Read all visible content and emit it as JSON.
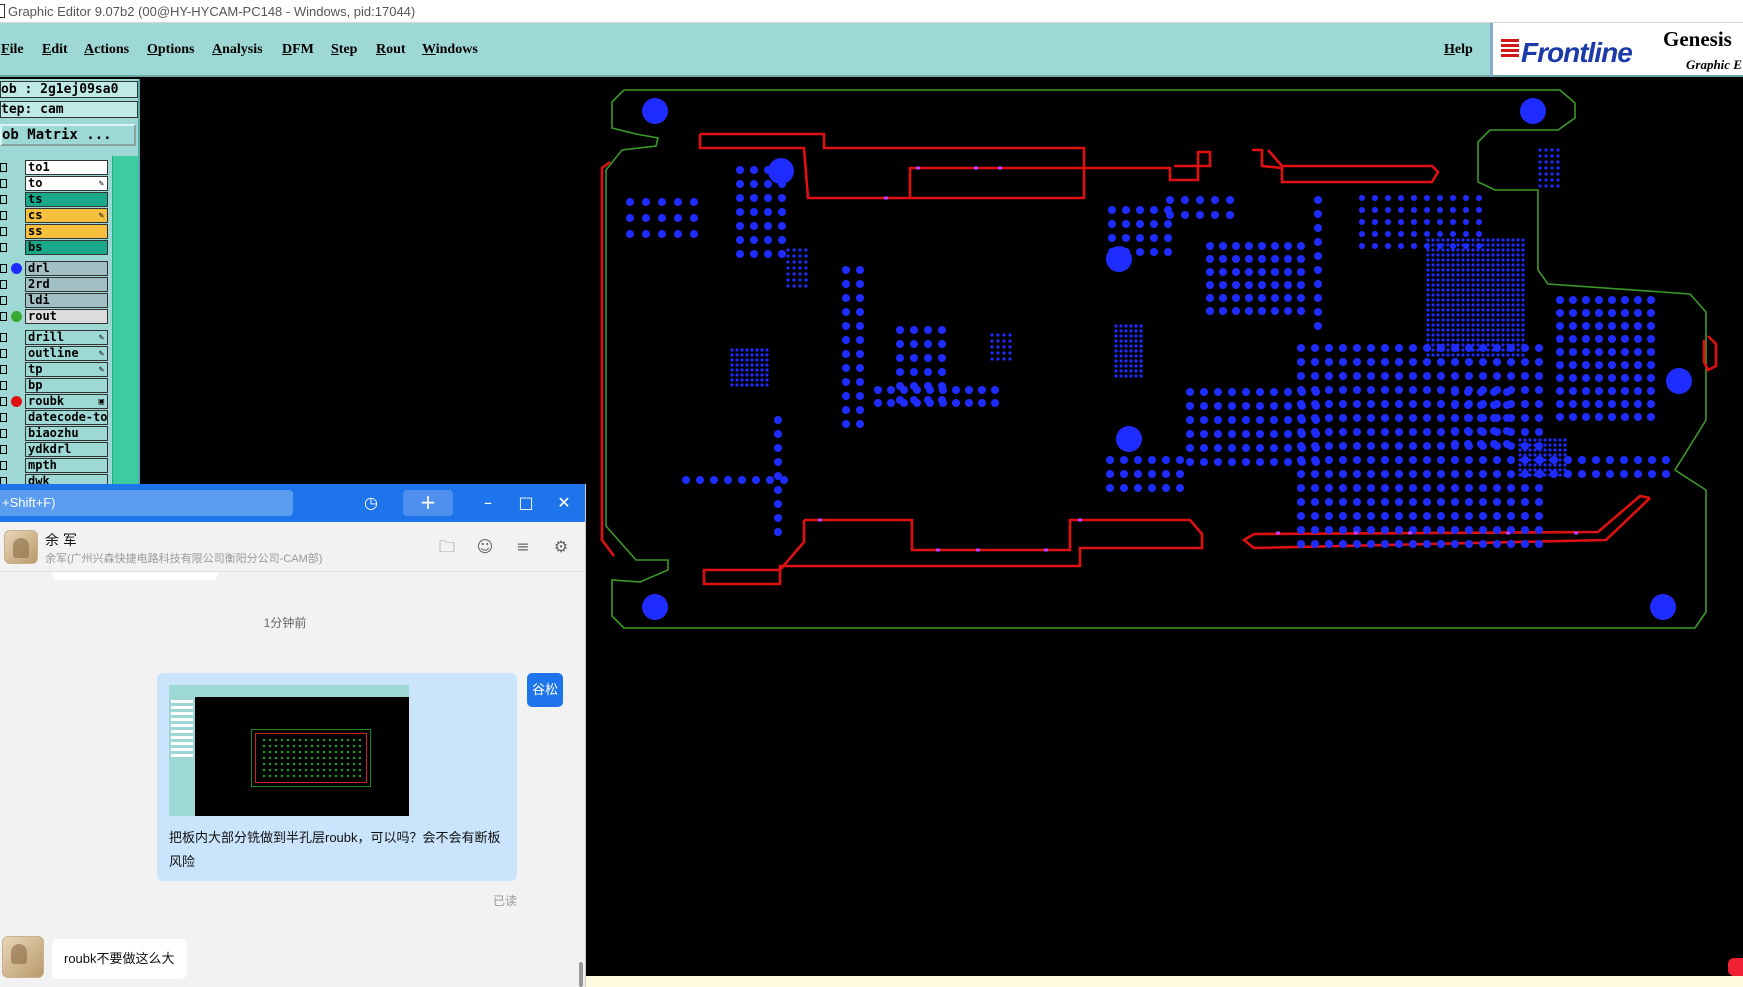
{
  "titlebar": {
    "title": "Graphic Editor 9.07b2 (00@HY-HYCAM-PC148 - Windows, pid:17044)"
  },
  "menubar": {
    "items": [
      "File",
      "Edit",
      "Actions",
      "Options",
      "Analysis",
      "DFM",
      "Step",
      "Rout",
      "Windows"
    ],
    "help": "Help"
  },
  "logo": {
    "brand": "Frontline",
    "product": "Genesis",
    "product_sub": "Graphic E"
  },
  "job_panel": {
    "job_line": "ob : 2g1ej09sa0",
    "step_line": "tep: cam",
    "matrix_button": "ob Matrix ..."
  },
  "layers": [
    {
      "name": "to1",
      "fill": "#ffffff",
      "dot": "",
      "mark": ""
    },
    {
      "name": "to",
      "fill": "#ffffff",
      "dot": "",
      "mark": "pen"
    },
    {
      "name": "ts",
      "fill": "#1aa88a",
      "dot": "",
      "mark": ""
    },
    {
      "name": "cs",
      "fill": "#f5bf40",
      "dot": "",
      "mark": "pen"
    },
    {
      "name": "ss",
      "fill": "#f5bf40",
      "dot": "",
      "mark": ""
    },
    {
      "name": "bs",
      "fill": "#1aa88a",
      "dot": "",
      "mark": ""
    },
    {
      "name": "drl",
      "fill": "#a3bfc6",
      "dot": "#1e2cff",
      "mark": ""
    },
    {
      "name": "2rd",
      "fill": "#a3bfc6",
      "dot": "",
      "mark": ""
    },
    {
      "name": "ldi",
      "fill": "#a3bfc6",
      "dot": "",
      "mark": ""
    },
    {
      "name": "rout",
      "fill": "#dcdcdc",
      "dot": "#3aa830",
      "mark": ""
    },
    {
      "name": "drill",
      "fill": "#9ed8d4",
      "dot": "",
      "mark": "pen"
    },
    {
      "name": "outline",
      "fill": "#9ed8d4",
      "dot": "",
      "mark": "pen"
    },
    {
      "name": "tp",
      "fill": "#9ed8d4",
      "dot": "",
      "mark": "pen"
    },
    {
      "name": "bp",
      "fill": "#9ed8d4",
      "dot": "",
      "mark": ""
    },
    {
      "name": "roubk",
      "fill": "#9ed8d4",
      "dot": "#e01010",
      "mark": "box"
    },
    {
      "name": "datecode-to",
      "fill": "#9ed8d4",
      "dot": "",
      "mark": ""
    },
    {
      "name": "biaozhu",
      "fill": "#9ed8d4",
      "dot": "",
      "mark": ""
    },
    {
      "name": "ydkdrl",
      "fill": "#9ed8d4",
      "dot": "",
      "mark": ""
    },
    {
      "name": "mpth",
      "fill": "#9ed8d4",
      "dot": "",
      "mark": ""
    },
    {
      "name": "dwk",
      "fill": "#9ed8d4",
      "dot": "",
      "mark": ""
    }
  ],
  "colors": {
    "board_outline": "#3c9a28",
    "rout_path": "#e01010",
    "drill": "#1e2cff",
    "slot_marker": "#c040ff",
    "accent": "#1e74ea"
  },
  "chat": {
    "search_placeholder": "+Shift+F)",
    "contact_name": "余 军",
    "contact_org": "余军(广州兴森快捷电路科技有限公司衡阳分公司-CAM部)",
    "time_label": "1分钟前",
    "sent_message": "把板内大部分铣做到半孔层roubk，可以吗？会不会有断板风险",
    "sender_badge": "谷松",
    "read_status": "已读",
    "reply_message": "roubk不要做这么大",
    "icons": [
      "history-icon",
      "plus-icon",
      "minimize-icon",
      "maximize-icon",
      "close-icon",
      "folder-icon",
      "add-user-icon",
      "search-record-icon",
      "settings-icon"
    ]
  }
}
